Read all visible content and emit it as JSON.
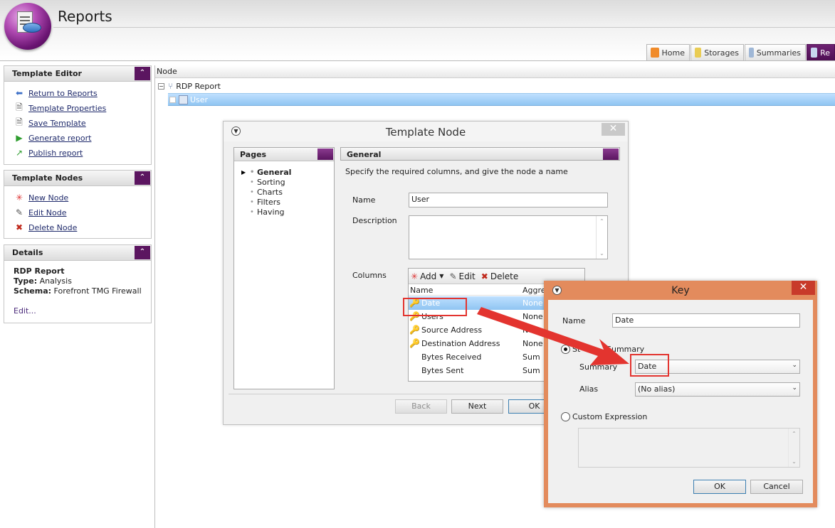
{
  "app": {
    "title": "Reports"
  },
  "tabs": [
    {
      "label": "Home",
      "icon": "home-icon"
    },
    {
      "label": "Storages",
      "icon": "storages-icon"
    },
    {
      "label": "Summaries",
      "icon": "summaries-icon"
    },
    {
      "label": "Re",
      "icon": "reports-icon"
    }
  ],
  "template_editor": {
    "title": "Template Editor",
    "items": [
      "Return to Reports",
      "Template Properties",
      "Save Template",
      "Generate report",
      "Publish report"
    ]
  },
  "template_nodes": {
    "title": "Template Nodes",
    "items": [
      "New Node",
      "Edit Node",
      "Delete Node"
    ]
  },
  "details": {
    "title": "Details",
    "name": "RDP Report",
    "type_label": "Type:",
    "type_value": "Analysis",
    "schema_label": "Schema:",
    "schema_value": "Forefront TMG Firewall",
    "edit_link": "Edit..."
  },
  "tree": {
    "header": "Node",
    "root": "RDP Report",
    "child": "User"
  },
  "template_node_dialog": {
    "title": "Template Node",
    "pages_title": "Pages",
    "pages": [
      "General",
      "Sorting",
      "Charts",
      "Filters",
      "Having"
    ],
    "general_title": "General",
    "instructions": "Specify the required columns, and give the node a name",
    "name_label": "Name",
    "name_value": "User",
    "description_label": "Description",
    "description_value": "",
    "columns_label": "Columns",
    "toolbar": {
      "add": "Add",
      "edit": "Edit",
      "delete": "Delete"
    },
    "col_headers": {
      "name": "Name",
      "aggregate": "Aggre"
    },
    "columns": [
      {
        "name": "Date",
        "aggregate": "None",
        "key": true
      },
      {
        "name": "Users",
        "aggregate": "None",
        "key": true
      },
      {
        "name": "Source Address",
        "aggregate": "None",
        "key": true
      },
      {
        "name": "Destination Address",
        "aggregate": "None",
        "key": true
      },
      {
        "name": "Bytes Received",
        "aggregate": "Sum",
        "key": false
      },
      {
        "name": "Bytes Sent",
        "aggregate": "Sum",
        "key": false
      }
    ],
    "buttons": {
      "back": "Back",
      "next": "Next",
      "ok": "OK"
    }
  },
  "key_dialog": {
    "title": "Key",
    "name_label": "Name",
    "name_value": "Date",
    "standard_summary_label_a": "St",
    "standard_summary_label_b": "Summary",
    "summary_label": "Summary",
    "summary_value": "Date",
    "alias_label": "Alias",
    "alias_value": "(No alias)",
    "custom_expression_label": "Custom Expression",
    "custom_expression_value": "",
    "buttons": {
      "ok": "OK",
      "cancel": "Cancel"
    }
  },
  "colors": {
    "accent": "#5b1560",
    "selection": "#8fc5f2",
    "key_dialog_border": "#e38b5d",
    "annotation": "#e3342f"
  }
}
